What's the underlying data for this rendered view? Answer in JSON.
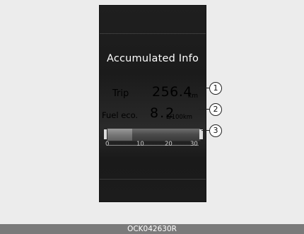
{
  "screen": {
    "title": "Accumulated Info",
    "trip": {
      "label": "Trip",
      "value": "256.4",
      "unit": "km"
    },
    "fuel_economy": {
      "label": "Fuel eco.",
      "value": "8.2",
      "unit": "L/100km"
    },
    "gauge": {
      "ticks": [
        "0",
        "10",
        "20",
        "30"
      ],
      "level_fraction": 0.27
    }
  },
  "callouts": [
    "1",
    "2",
    "3"
  ],
  "footer_code": "OCK042630R",
  "colors": {
    "panel": "#1f1f1f",
    "background": "#ececec",
    "footer": "#7a7a7a"
  }
}
